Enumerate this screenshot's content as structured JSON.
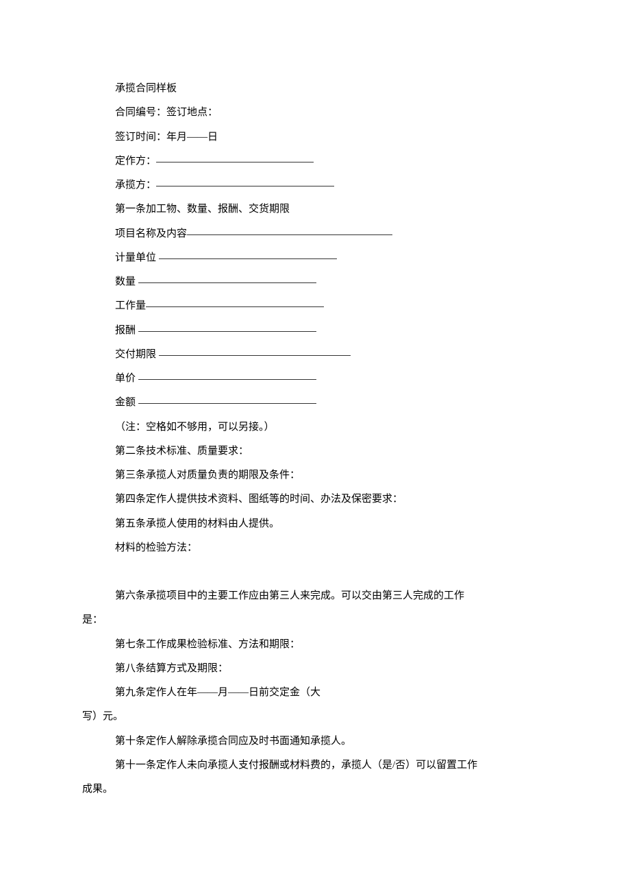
{
  "lines": {
    "l1": "承揽合同样板",
    "l2": "合同编号：签订地点：",
    "l3": "签订时间：年月——日",
    "l4": "定作方：",
    "l5": "承揽方：",
    "l6": "第一条加工物、数量、报酬、交货期限",
    "l7": "项目名称及内容",
    "l8": "计量单位",
    "l9": "数量",
    "l10": "工作量",
    "l11": "报酬",
    "l12": "交付期限",
    "l13": "单价",
    "l14": "金额",
    "l15": "（注：空格如不够用，可以另接。）",
    "l16": "第二条技术标准、质量要求：",
    "l17": "第三条承揽人对质量负责的期限及条件：",
    "l18": "第四条定作人提供技术资料、图纸等的时间、办法及保密要求：",
    "l19": "第五条承揽人使用的材料由人提供。",
    "l20": "材料的检验方法：",
    "l21a": "第六条承揽项目中的主要工作应由第三人来完成。可以交由第三人完成的工作",
    "l21b": "是：",
    "l22": "第七条工作成果检验标准、方法和期限：",
    "l23": "第八条结算方式及期限：",
    "l24a": "第九条定作人在年——月——日前交定金（大",
    "l24b": "写）元。",
    "l25": "第十条定作人解除承揽合同应及时书面通知承揽人。",
    "l26a": "第十一条定作人未向承揽人支付报酬或材料费的，承揽人（是/否）可以留置工作",
    "l26b": "成果。"
  }
}
